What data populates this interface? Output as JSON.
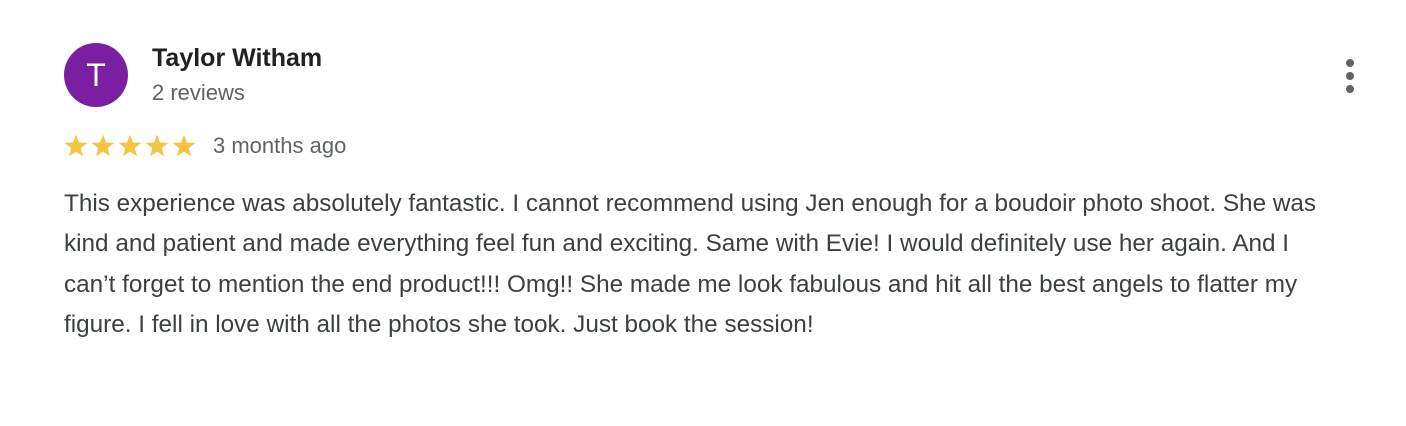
{
  "review": {
    "avatar_letter": "T",
    "avatar_color": "#7b1fa2",
    "author_name": "Taylor Witham",
    "review_count": "2 reviews",
    "rating": 5,
    "rating_max": 5,
    "star_color": "#f4c542",
    "date": "3 months ago",
    "text": "This experience was absolutely fantastic. I cannot recommend using Jen enough for a boudoir photo shoot. She was kind and patient and made everything feel fun and exciting. Same with Evie! I would definitely use her again. And I can’t forget to mention the end product!!! Omg!! She made me look fabulous and hit all the best angels to flatter my figure. I fell in love with all the photos she took. Just book the session!",
    "more_icon": "more-vertical-icon"
  }
}
